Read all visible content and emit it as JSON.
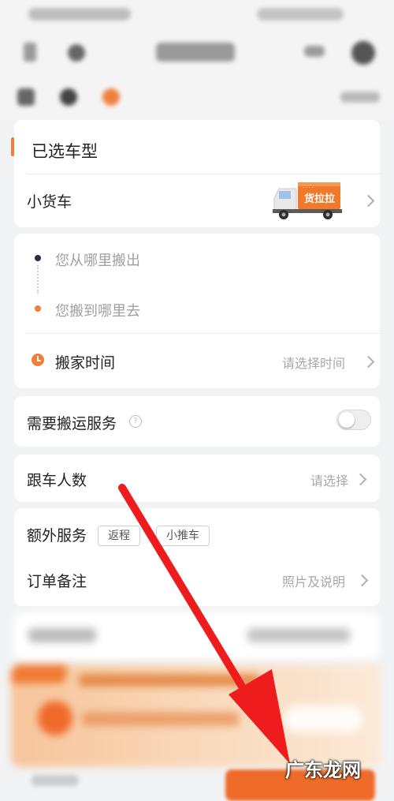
{
  "colors": {
    "accent": "#f07f3c",
    "arrow": "#ee1c1c",
    "text": "#222222",
    "hint": "#a8a8a8"
  },
  "vehicle": {
    "section_title": "已选车型",
    "type": "小货车",
    "truck_brand": "货拉拉"
  },
  "route": {
    "from_placeholder": "您从哪里搬出",
    "to_placeholder": "您搬到哪里去",
    "time_label": "搬家时间",
    "time_placeholder": "请选择时间"
  },
  "service": {
    "label": "需要搬运服务",
    "help_icon": "?",
    "enabled": false
  },
  "passengers": {
    "label": "跟车人数",
    "placeholder": "请选择"
  },
  "extras": {
    "label": "额外服务",
    "chips": [
      "返程",
      "小推车"
    ]
  },
  "notes": {
    "label": "订单备注",
    "placeholder": "照片及说明"
  },
  "watermark": "广东龙网"
}
